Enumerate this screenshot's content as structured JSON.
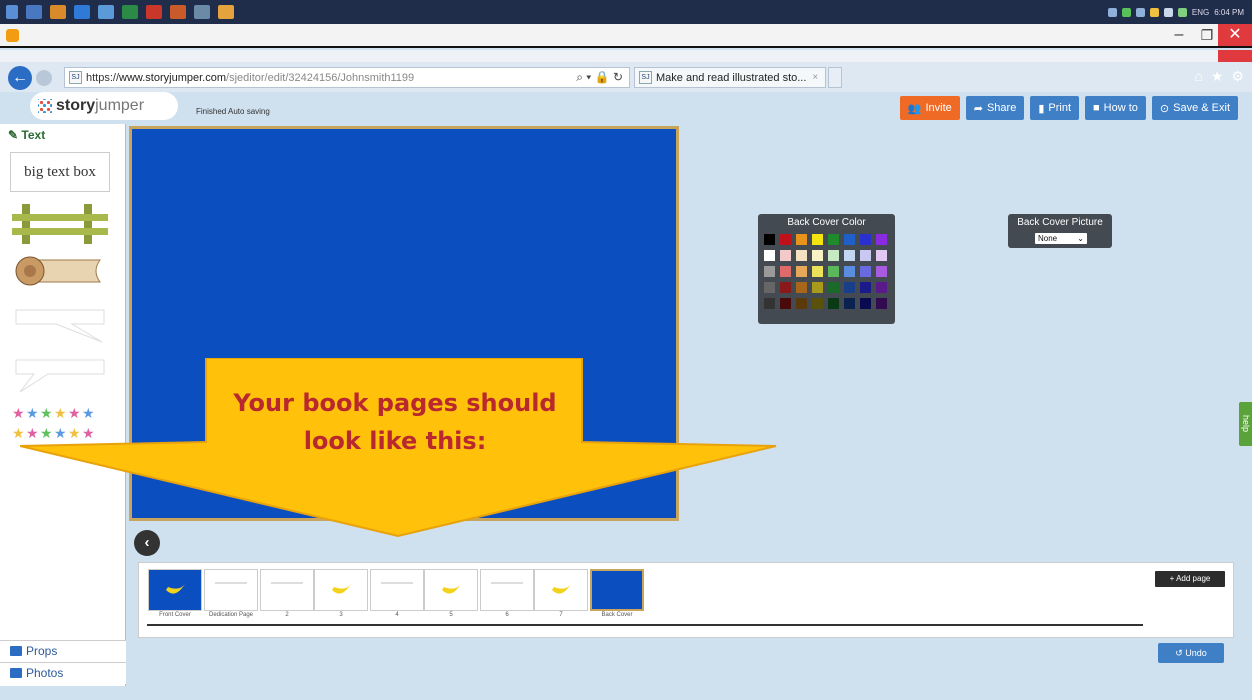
{
  "taskbar": {
    "icons": [
      "windows-icon",
      "app-icon-1",
      "app-icon-2",
      "edge-icon",
      "app-icon-3",
      "excel-icon",
      "app-icon-4",
      "powerpoint-icon",
      "app-icon-5",
      "app-icon-6"
    ],
    "language": "ENG",
    "time": "6:04 PM"
  },
  "browser": {
    "url_prefix": "https://",
    "url_host": "www.storyjumper.com",
    "url_rest": "/sjeditor/edit/32424156/Johnsmith1199",
    "tab_title": "Make and read illustrated sto...",
    "tab_close": "×"
  },
  "header": {
    "logo_bold": "story",
    "logo_light": "jumper",
    "autosave": "Finished Auto saving",
    "buttons": {
      "invite": "Invite",
      "share": "Share",
      "print": "Print",
      "howto": "How to",
      "save_exit": "Save & Exit"
    }
  },
  "sidebar": {
    "title": "Text",
    "big_text": "big text box",
    "props": "Props",
    "photos": "Photos"
  },
  "color_panel": {
    "title": "Back Cover Color",
    "colors": [
      "#000000",
      "#c0111b",
      "#e8931c",
      "#f2e311",
      "#1f8a2b",
      "#1f5fc8",
      "#2a2fd0",
      "#8a2be2",
      "#ffffff",
      "#f4c9c9",
      "#f4e1c2",
      "#f7f3c2",
      "#c8eac2",
      "#c2d6f2",
      "#c8c8f2",
      "#e2c8f2",
      "#9a9a9a",
      "#e06a6a",
      "#e8a85a",
      "#ece25a",
      "#5ab85a",
      "#5a8ce0",
      "#6a6ae0",
      "#a85ae0",
      "#666666",
      "#8a1a1a",
      "#a8661a",
      "#a89a1a",
      "#1a6a2a",
      "#1a3f8a",
      "#1a1a8a",
      "#5a1a8a",
      "#333333",
      "#4a0a0a",
      "#5a3a0a",
      "#5a520a",
      "#0a3a14",
      "#0a2250",
      "#0a0a50",
      "#320a50"
    ]
  },
  "picture_panel": {
    "title": "Back Cover Picture",
    "selected": "None"
  },
  "callout": {
    "line1": "Your book pages should",
    "line2": "look like this:"
  },
  "pages": {
    "labels": [
      "Front Cover",
      "Dedication Page",
      "2",
      "3",
      "4",
      "5",
      "6",
      "7",
      "Back Cover"
    ],
    "add_page": "+ Add page",
    "undo": "Undo"
  },
  "help": "help"
}
